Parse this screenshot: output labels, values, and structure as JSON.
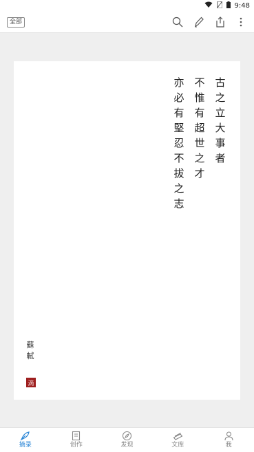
{
  "status_bar": {
    "time": "9:48",
    "icons": [
      "wifi-icon",
      "no-sim-icon",
      "battery-icon"
    ]
  },
  "toolbar": {
    "filter_label": "全部",
    "actions": [
      "search-icon",
      "pen-icon",
      "share-icon",
      "more-vertical-icon"
    ]
  },
  "poem": {
    "columns": [
      "古之立大事者",
      "不惟有超世之才",
      "亦必有堅忍不拔之志"
    ]
  },
  "author": "蘇軾",
  "seal": "滴",
  "bottom_nav": {
    "items": [
      {
        "label": "摘录",
        "icon": "quill-icon",
        "active": true
      },
      {
        "label": "创作",
        "icon": "notebook-icon",
        "active": false
      },
      {
        "label": "发现",
        "icon": "compass-icon",
        "active": false
      },
      {
        "label": "文库",
        "icon": "books-icon",
        "active": false
      },
      {
        "label": "我",
        "icon": "user-icon",
        "active": false
      }
    ]
  },
  "colors": {
    "accent": "#2b86d6",
    "seal": "#9e1f1f",
    "background": "#efefef"
  }
}
